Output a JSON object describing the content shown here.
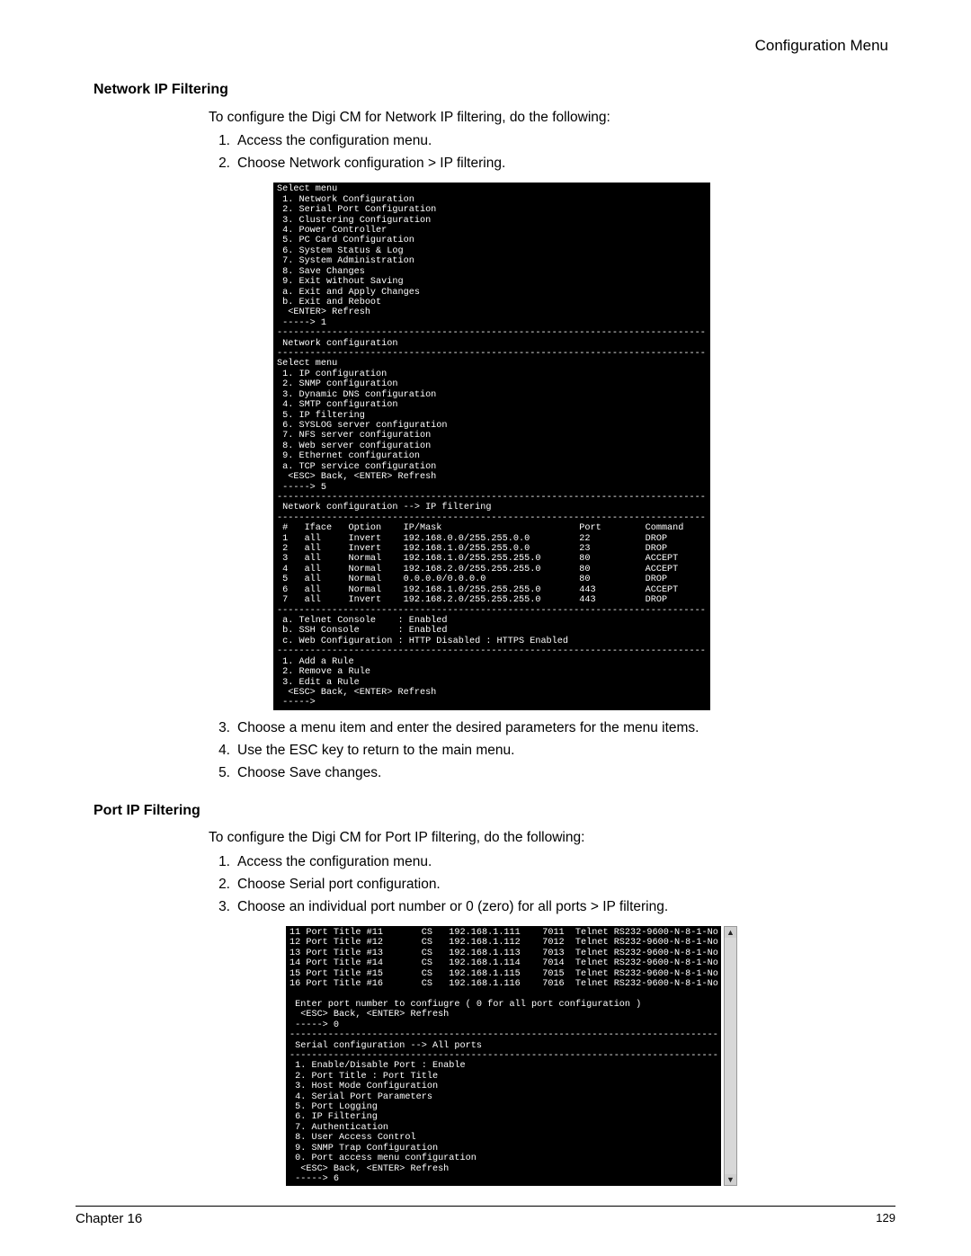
{
  "header": {
    "right": "Configuration Menu"
  },
  "sections": {
    "network": {
      "heading": "Network IP Filtering",
      "intro": "To configure the Digi CM for Network IP filtering, do the following:",
      "step1": "Access the configuration menu.",
      "step2": "Choose Network configuration > IP filtering.",
      "step3": "Choose a menu item and enter the desired parameters for the menu items.",
      "step4": "Use the ESC key to return to the main menu.",
      "step5": "Choose Save changes."
    },
    "port": {
      "heading": "Port IP Filtering",
      "intro": "To configure the Digi CM for Port IP filtering, do the following:",
      "step1": "Access the configuration menu.",
      "step2": "Choose Serial port configuration.",
      "step3": "Choose an individual port number or 0 (zero) for all ports > IP filtering."
    }
  },
  "terminal1": "Select menu\n 1. Network Configuration\n 2. Serial Port Configuration\n 3. Clustering Configuration\n 4. Power Controller\n 5. PC Card Configuration\n 6. System Status & Log\n 7. System Administration\n 8. Save Changes\n 9. Exit without Saving\n a. Exit and Apply Changes\n b. Exit and Reboot\n  <ENTER> Refresh\n -----> 1\n------------------------------------------------------------------------------\n Network configuration\n------------------------------------------------------------------------------\nSelect menu\n 1. IP configuration\n 2. SNMP configuration\n 3. Dynamic DNS configuration\n 4. SMTP configuration\n 5. IP filtering\n 6. SYSLOG server configuration\n 7. NFS server configuration\n 8. Web server configuration\n 9. Ethernet configuration\n a. TCP service configuration\n  <ESC> Back, <ENTER> Refresh\n -----> 5\n------------------------------------------------------------------------------\n Network configuration --> IP filtering\n------------------------------------------------------------------------------\n #   Iface   Option    IP/Mask                         Port        Command\n 1   all     Invert    192.168.0.0/255.255.0.0         22          DROP\n 2   all     Invert    192.168.1.0/255.255.0.0         23          DROP\n 3   all     Normal    192.168.1.0/255.255.255.0       80          ACCEPT\n 4   all     Normal    192.168.2.0/255.255.255.0       80          ACCEPT\n 5   all     Normal    0.0.0.0/0.0.0.0                 80          DROP\n 6   all     Normal    192.168.1.0/255.255.255.0       443         ACCEPT\n 7   all     Invert    192.168.2.0/255.255.255.0       443         DROP\n------------------------------------------------------------------------------\n a. Telnet Console    : Enabled\n b. SSH Console       : Enabled\n c. Web Configuration : HTTP Disabled : HTTPS Enabled\n------------------------------------------------------------------------------\n 1. Add a Rule\n 2. Remove a Rule\n 3. Edit a Rule\n  <ESC> Back, <ENTER> Refresh\n ----->",
  "terminal2": "11 Port Title #11       CS   192.168.1.111    7011  Telnet RS232-9600-N-8-1-No\n12 Port Title #12       CS   192.168.1.112    7012  Telnet RS232-9600-N-8-1-No\n13 Port Title #13       CS   192.168.1.113    7013  Telnet RS232-9600-N-8-1-No\n14 Port Title #14       CS   192.168.1.114    7014  Telnet RS232-9600-N-8-1-No\n15 Port Title #15       CS   192.168.1.115    7015  Telnet RS232-9600-N-8-1-No\n16 Port Title #16       CS   192.168.1.116    7016  Telnet RS232-9600-N-8-1-No\n\n Enter port number to confiugre ( 0 for all port configuration )\n  <ESC> Back, <ENTER> Refresh\n -----> 0\n------------------------------------------------------------------------------\n Serial configuration --> All ports\n------------------------------------------------------------------------------\n 1. Enable/Disable Port : Enable\n 2. Port Title : Port Title\n 3. Host Mode Configuration\n 4. Serial Port Parameters\n 5. Port Logging\n 6. IP Filtering\n 7. Authentication\n 8. User Access Control\n 9. SNMP Trap Configuration\n 0. Port access menu configuration\n  <ESC> Back, <ENTER> Refresh\n -----> 6",
  "footer": {
    "chapter": "Chapter 16",
    "page": "129"
  }
}
